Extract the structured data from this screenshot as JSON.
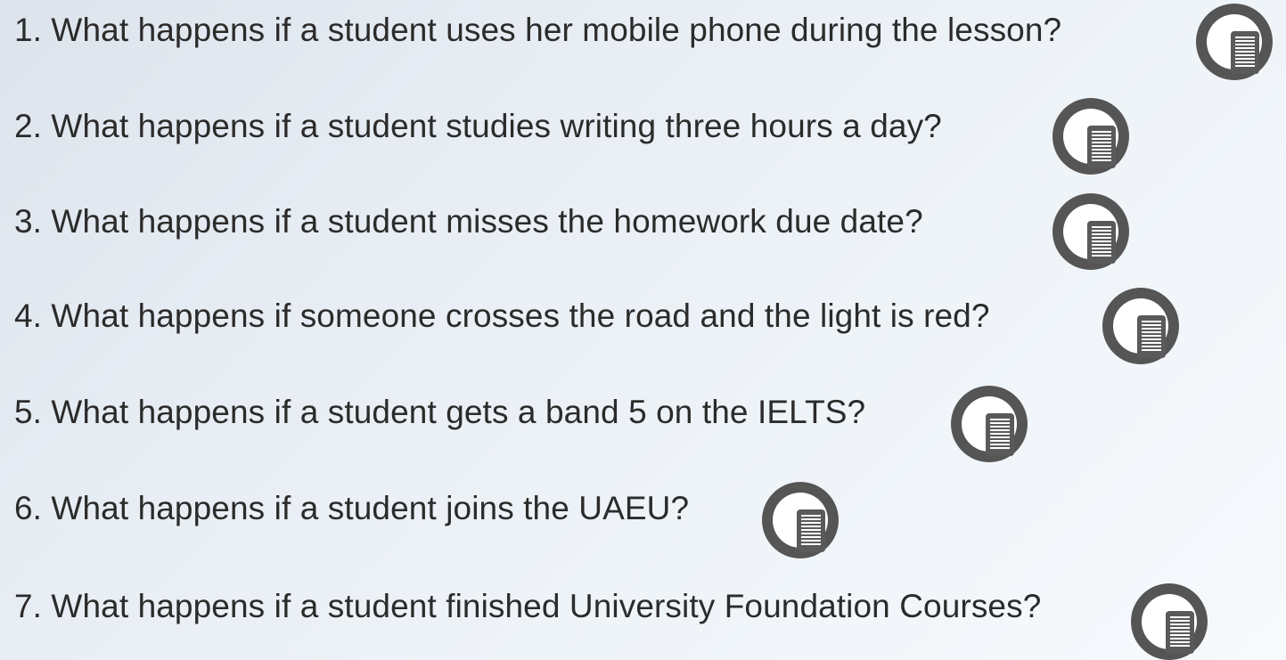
{
  "questions": [
    {
      "text": "1. What happens if a student uses her mobile phone during the lesson?",
      "icon": "notes-icon"
    },
    {
      "text": "2. What happens if a student studies writing three hours a day?",
      "icon": "notes-icon"
    },
    {
      "text": "3. What happens if a student misses the homework due date?",
      "icon": "notes-icon"
    },
    {
      "text": "4. What happens if someone crosses the road and the light is red?",
      "icon": "notes-icon"
    },
    {
      "text": "5. What happens if a student gets a band 5 on the IELTS?",
      "icon": "notes-icon"
    },
    {
      "text": "6. What happens if a student joins the UAEU?",
      "icon": "notes-icon"
    },
    {
      "text": "7. What happens if a student finished University Foundation Courses?",
      "icon": "notes-icon"
    }
  ],
  "colors": {
    "text": "#2b2b2b",
    "icon_ring": "#555555",
    "icon_fill": "#ffffff",
    "background_start": "#dde4ec",
    "background_end": "#f7fafd"
  }
}
